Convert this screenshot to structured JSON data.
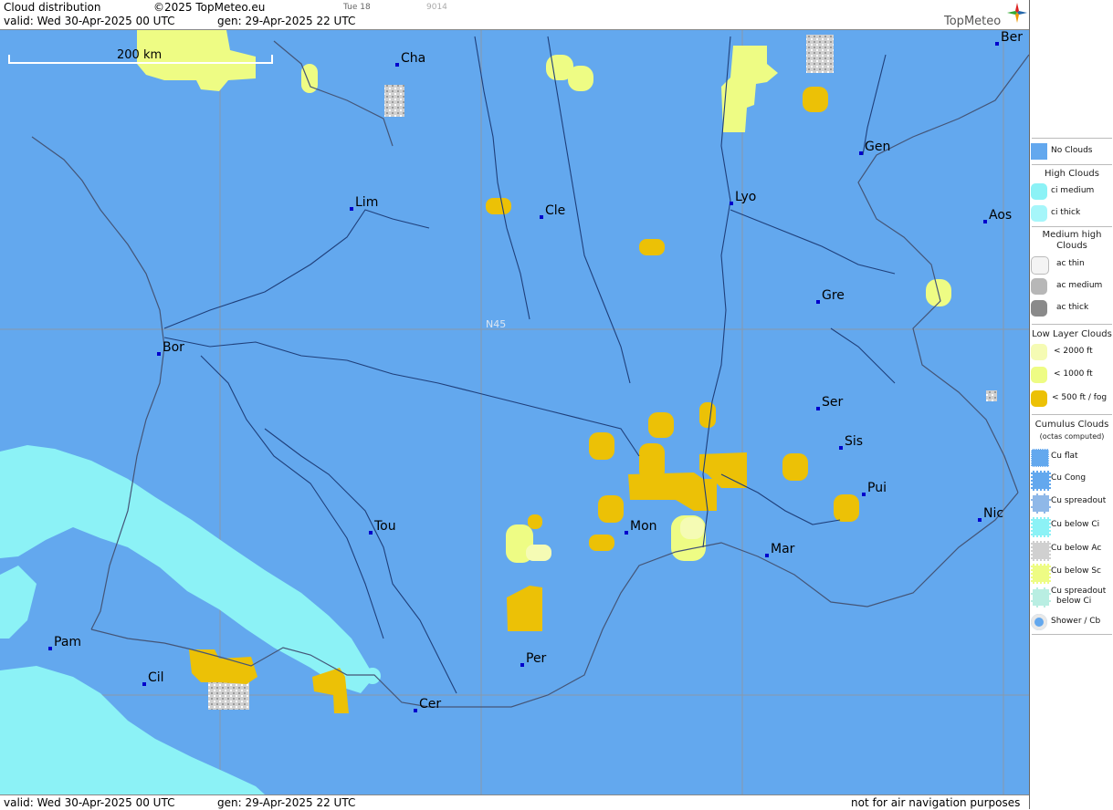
{
  "header": {
    "title": "Cloud distribution",
    "copyright": "©2025 TopMeteo.eu",
    "valid": "valid:  Wed  30-Apr-2025  00 UTC",
    "gen": "gen:  29-Apr-2025 22 UTC",
    "small_day": "Tue 18",
    "small_code": "9014",
    "logo": "TopMeteo"
  },
  "footer": {
    "valid": "valid:  Wed  30-Apr-2025  00 UTC",
    "gen": "gen:  29-Apr-2025 22 UTC",
    "notice": "not for air navigation purposes"
  },
  "map": {
    "scale_label": "200 km",
    "lat_label": "N45",
    "colors": {
      "no_clouds": "#63a8ee",
      "ci_medium": "#8cf2f6",
      "low_2000": "#f5fbb4",
      "low_1000": "#eefc84",
      "low_500": "#ecc106",
      "cu_below_ac": "#c9c9c9",
      "rivers": "#1f3f7a",
      "borders": "#555577",
      "grid": "#8899aa"
    },
    "cities": [
      {
        "name": "Ber"
      },
      {
        "name": "Cha"
      },
      {
        "name": "Gen"
      },
      {
        "name": "Lim"
      },
      {
        "name": "Cle"
      },
      {
        "name": "Lyo"
      },
      {
        "name": "Aos"
      },
      {
        "name": "Gre"
      },
      {
        "name": "Bor"
      },
      {
        "name": "Ser"
      },
      {
        "name": "Sis"
      },
      {
        "name": "Pui"
      },
      {
        "name": "Tou"
      },
      {
        "name": "Mon"
      },
      {
        "name": "Nic"
      },
      {
        "name": "Mar"
      },
      {
        "name": "Pam"
      },
      {
        "name": "Per"
      },
      {
        "name": "Cil"
      },
      {
        "name": "Cer"
      }
    ]
  },
  "legend": {
    "no_clouds": "No Clouds",
    "high_title": "High Clouds",
    "ci_medium": "ci medium",
    "ci_thick": "ci thick",
    "medium_title_1": "Medium high",
    "medium_title_2": "Clouds",
    "ac_thin": "ac thin",
    "ac_medium": "ac medium",
    "ac_thick": "ac thick",
    "low_title": "Low Layer Clouds",
    "low_2000": "< 2000 ft",
    "low_1000": "< 1000 ft",
    "low_500": "< 500 ft / fog",
    "cu_title_1": "Cumulus Clouds",
    "cu_title_2": "(octas computed)",
    "cu_flat": "Cu flat",
    "cu_cong": "Cu Cong",
    "cu_spreadout": "Cu spreadout",
    "cu_below_ci": "Cu below Ci",
    "cu_below_ac": "Cu below Ac",
    "cu_below_sc": "Cu below Sc",
    "cu_spread_ci_1": "Cu spreadout",
    "cu_spread_ci_2": "below Ci",
    "shower": "Shower / Cb"
  }
}
